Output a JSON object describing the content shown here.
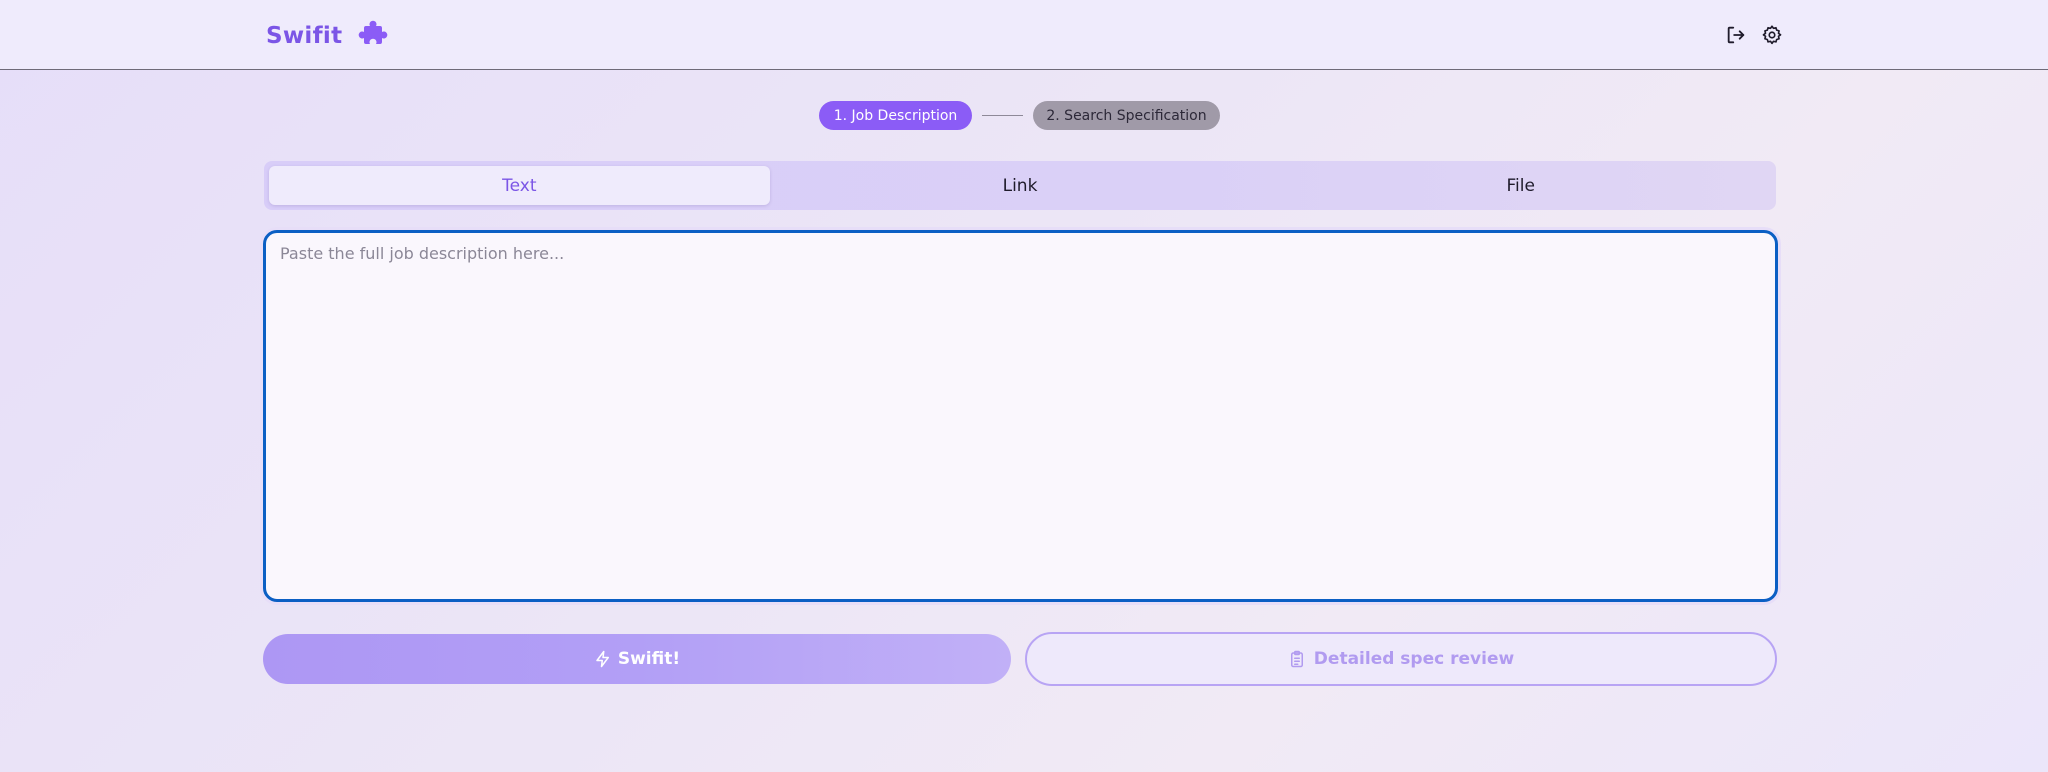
{
  "header": {
    "brand": "Swifit",
    "logo_icon": "puzzle-piece-icon",
    "actions": [
      {
        "icon": "logout-icon",
        "label": "Log out"
      },
      {
        "icon": "gear-icon",
        "label": "Settings"
      }
    ]
  },
  "stepper": {
    "steps": [
      {
        "label": "1. Job Description",
        "active": true
      },
      {
        "label": "2. Search Specification",
        "active": false
      }
    ]
  },
  "tabs": [
    {
      "label": "Text",
      "active": true
    },
    {
      "label": "Link",
      "active": false
    },
    {
      "label": "File",
      "active": false
    }
  ],
  "editor": {
    "placeholder": "Paste the full job description here...",
    "value": ""
  },
  "buttons": {
    "primary": {
      "label": "Swifit!",
      "icon": "lightning-icon"
    },
    "secondary": {
      "label": "Detailed spec review",
      "icon": "clipboard-icon"
    }
  },
  "colors": {
    "accent": "#8b5cf6",
    "brand_text": "#7b55e6",
    "focus_border": "#0b5fc4",
    "step_inactive": "#a09aa8"
  }
}
